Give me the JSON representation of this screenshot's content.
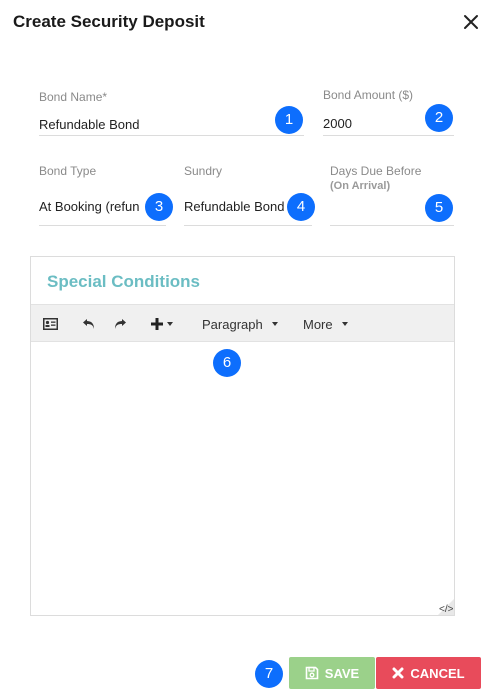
{
  "dialog": {
    "title": "Create Security Deposit"
  },
  "form": {
    "bond_name": {
      "label": "Bond Name*",
      "value": "Refundable Bond"
    },
    "bond_amount": {
      "label": "Bond Amount ($)",
      "value": "2000"
    },
    "bond_type": {
      "label": "Bond Type",
      "value": "At Booking (refun"
    },
    "sundry": {
      "label": "Sundry",
      "value": "Refundable Bond"
    },
    "days_due": {
      "label": "Days Due Before",
      "sublabel": "(On Arrival)",
      "value": ""
    }
  },
  "editor": {
    "title": "Special Conditions",
    "toolbar": {
      "paragraph_label": "Paragraph",
      "more_label": "More"
    }
  },
  "badges": [
    "1",
    "2",
    "3",
    "4",
    "5",
    "6",
    "7"
  ],
  "buttons": {
    "save_label": "SAVE",
    "cancel_label": "CANCEL"
  },
  "colors": {
    "badge": "#0d6efd",
    "save": "#9bd18a",
    "cancel": "#e84b5b",
    "editor_title": "#6bbdc3"
  }
}
